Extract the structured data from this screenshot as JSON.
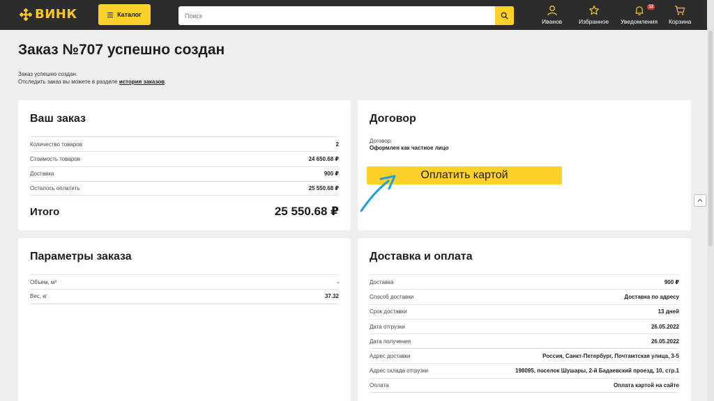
{
  "header": {
    "logo_text": "ВИНК",
    "catalog_label": "Каталог",
    "search_placeholder": "Поиск",
    "nav": {
      "profile": "Иванов",
      "favorites": "Избранное",
      "notifications": "Уведомления",
      "notifications_badge": "12",
      "cart": "Корзина"
    }
  },
  "page": {
    "title": "Заказ №707 успешно создан",
    "notice_line1": "Заказ успешно создан.",
    "notice_line2_prefix": "Отследить заказ вы можете в разделе",
    "notice_link": "история заказов",
    "notice_suffix": "."
  },
  "order_card": {
    "title": "Ваш заказ",
    "rows": [
      {
        "label": "Количество товаров",
        "value": "2"
      },
      {
        "label": "Стоимость товаров",
        "value": "24 650.68 ₽"
      },
      {
        "label": "Доставка",
        "value": "900 ₽"
      },
      {
        "label": "Осталось оплатить",
        "value": "25 550.68 ₽"
      }
    ],
    "total_label": "Итого",
    "total_value": "25 550.68 ₽"
  },
  "contract_card": {
    "title": "Договор",
    "label": "Договор:",
    "value": "Оформлен как частное лицо",
    "pay_button": "Оплатить картой"
  },
  "params_card": {
    "title": "Параметры заказа",
    "rows": [
      {
        "label": "Объем, м³",
        "value": "-"
      },
      {
        "label": "Вес, кг",
        "value": "37.32"
      }
    ]
  },
  "delivery_card": {
    "title": "Доставка и оплата",
    "rows": [
      {
        "label": "Доставка",
        "value": "900 ₽"
      },
      {
        "label": "Способ доставки",
        "value": "Доставка по адресу"
      },
      {
        "label": "Срок доставки",
        "value": "13 дней"
      },
      {
        "label": "Дата отгрузки",
        "value": "26.05.2022"
      },
      {
        "label": "Дата получения",
        "value": "26.05.2022"
      },
      {
        "label": "Адрес доставки",
        "value": "Россия, Санкт-Петербург, Почтамтская улица, 3-5"
      },
      {
        "label": "Адрес склада отгрузки",
        "value": "198095, поселок Шушары, 2-й Бадаевский проезд, 10, стр.1"
      },
      {
        "label": "Оплата",
        "value": "Оплата картой на сайте"
      }
    ]
  },
  "colors": {
    "accent": "#fbd12a",
    "header_bg": "#2c2c2c",
    "arrow": "#1e9fdc"
  }
}
